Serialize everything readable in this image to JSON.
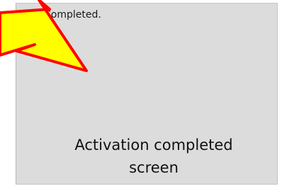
{
  "dialog": {
    "status_text": "Completed.",
    "icon": "info-icon",
    "background": "#dcdcdc"
  },
  "annotation": {
    "caption_line1": "Activation completed",
    "caption_line2": "screen",
    "arrow_fill": "#ffff00",
    "arrow_stroke": "#ff0000"
  }
}
